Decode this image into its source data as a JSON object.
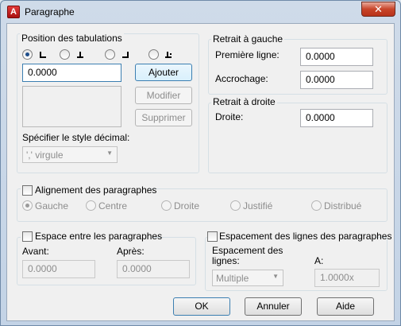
{
  "window": {
    "title": "Paragraphe",
    "close_glyph": "✕"
  },
  "tabs_group": {
    "title": "Position des tabulations",
    "tab_types": [
      "left-tab-icon",
      "center-tab-icon",
      "right-tab-icon",
      "decimal-tab-icon"
    ],
    "position_value": "0.0000",
    "add_label": "Ajouter",
    "modify_label": "Modifier",
    "delete_label": "Supprimer",
    "decimal_style_label": "Spécifier le style décimal:",
    "decimal_style_value": "',' virgule"
  },
  "left_indent": {
    "title": "Retrait à gauche",
    "first_line_label": "Première ligne:",
    "first_line_value": "0.0000",
    "hanging_label": "Accrochage:",
    "hanging_value": "0.0000"
  },
  "right_indent": {
    "title": "Retrait à droite",
    "right_label": "Droite:",
    "right_value": "0.0000"
  },
  "alignment": {
    "title": "Alignement des paragraphes",
    "options": [
      "Gauche",
      "Centre",
      "Droite",
      "Justifié",
      "Distribué"
    ]
  },
  "spacing": {
    "title": "Espace entre les paragraphes",
    "before_label": "Avant:",
    "before_value": "0.0000",
    "after_label": "Après:",
    "after_value": "0.0000"
  },
  "line_spacing": {
    "title": "Espacement des lignes des paragraphes",
    "spacing_label_1": "Espacement des",
    "spacing_label_2": "lignes:",
    "spacing_value": "Multiple",
    "at_label": "A:",
    "at_value": "1.0000x"
  },
  "buttons": {
    "ok": "OK",
    "cancel": "Annuler",
    "help": "Aide"
  },
  "colors": {
    "accent": "#3c7fb1",
    "close": "#c8452a",
    "disabled_text": "#8d8d8d"
  }
}
